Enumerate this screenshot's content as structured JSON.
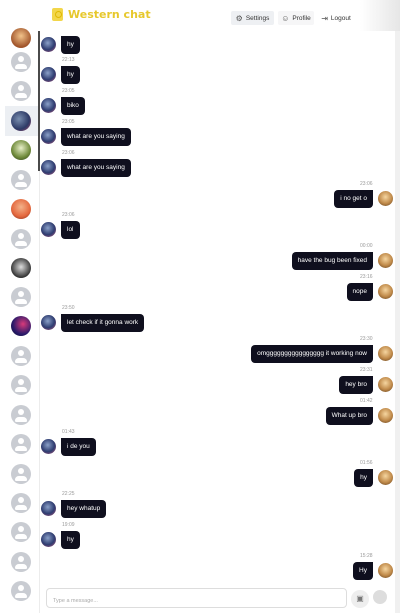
{
  "header": {
    "title": "Western chat",
    "settings_label": "Settings",
    "profile_label": "Profile",
    "logout_label": "Logout"
  },
  "sidebar": {
    "items": [
      "photo",
      "default",
      "photo",
      "photo",
      "default",
      "photo",
      "default",
      "photo",
      "default",
      "photo",
      "default",
      "default",
      "default",
      "default",
      "default",
      "default",
      "default",
      "default",
      "default",
      "default"
    ]
  },
  "messages": [
    {
      "time": "",
      "text": "hy",
      "dir": "in"
    },
    {
      "time": "22:13",
      "text": "hy",
      "dir": "in"
    },
    {
      "time": "23:05",
      "text": "biko",
      "dir": "in"
    },
    {
      "time": "23:05",
      "text": "what are you saying",
      "dir": "in"
    },
    {
      "time": "23:06",
      "text": "what are you saying",
      "dir": "in"
    },
    {
      "time": "23:06",
      "text": "i no get o",
      "dir": "out"
    },
    {
      "time": "23:06",
      "text": "lol",
      "dir": "in"
    },
    {
      "time": "00:00",
      "text": "have the bug been fixed",
      "dir": "out"
    },
    {
      "time": "23:16",
      "text": "nope",
      "dir": "out"
    },
    {
      "time": "23:50",
      "text": "let check if it gonna work",
      "dir": "in"
    },
    {
      "time": "23:30",
      "text": "omgggggggggggggggg it working now",
      "dir": "out"
    },
    {
      "time": "23:31",
      "text": "hey bro",
      "dir": "out"
    },
    {
      "time": "01:42",
      "text": "What up bro",
      "dir": "out"
    },
    {
      "time": "01:43",
      "text": "i de you",
      "dir": "in"
    },
    {
      "time": "01:56",
      "text": "hy",
      "dir": "out"
    },
    {
      "time": "22:25",
      "text": "hey whatup",
      "dir": "in"
    },
    {
      "time": "19:09",
      "text": "hy",
      "dir": "in"
    },
    {
      "time": "15:28",
      "text": "Hy",
      "dir": "out"
    }
  ],
  "composer": {
    "placeholder": "Type a message..."
  },
  "icons": {
    "settings": "gear-icon",
    "profile": "user-icon",
    "logout": "logout-icon",
    "attach": "image-icon",
    "send": "send-icon"
  },
  "colors": {
    "brand": "#e7c82c",
    "bubble": "#0f0f1e"
  }
}
